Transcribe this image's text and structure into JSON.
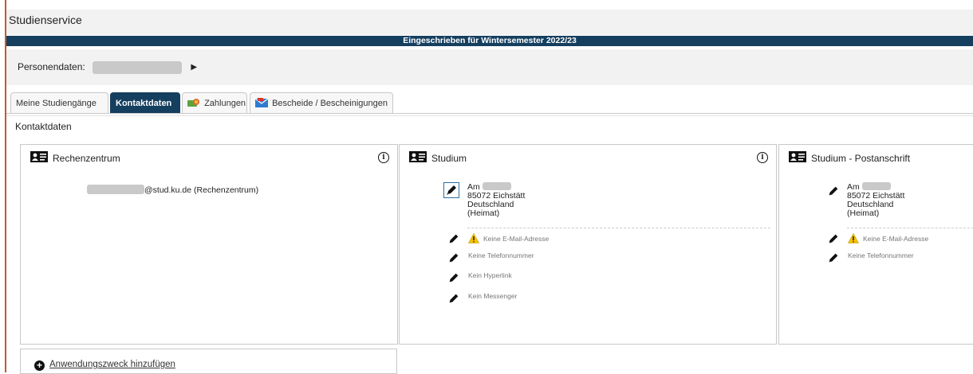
{
  "header": {
    "title": "Studienservice"
  },
  "banner": {
    "text": "Eingeschrieben für Wintersemester 2022/23"
  },
  "persona": {
    "label": "Personendaten:"
  },
  "tabs": [
    {
      "label": "Meine Studiengänge"
    },
    {
      "label": "Kontaktdaten"
    },
    {
      "label": "Zahlungen"
    },
    {
      "label": "Bescheide / Bescheinigungen"
    }
  ],
  "section": {
    "title": "Kontaktdaten"
  },
  "cards": {
    "rechenzentrum": {
      "title": "Rechenzentrum",
      "email_suffix": "@stud.ku.de (Rechenzentrum)"
    },
    "studium": {
      "title": "Studium",
      "address": {
        "street_prefix": "Am",
        "city": "85072 Eichstätt",
        "country": "Deutschland",
        "type": "(Heimat)"
      },
      "contacts": {
        "email": "Keine E-Mail-Adresse",
        "phone": "Keine Telefonnummer",
        "hyperlink": "Kein Hyperlink",
        "messenger": "Kein Messenger"
      }
    },
    "postanschrift": {
      "title": "Studium - Postanschrift",
      "address": {
        "street_prefix": "Am",
        "city": "85072 Eichstätt",
        "country": "Deutschland",
        "type": "(Heimat)"
      },
      "contacts": {
        "email": "Keine E-Mail-Adresse",
        "phone": "Keine Telefonnummer"
      }
    }
  },
  "actions": {
    "add_purpose": "Anwendungszweck hinzufügen"
  },
  "colors": {
    "primary": "#153f5f",
    "accent_rule": "#c65a2a",
    "warning": "#f5c400"
  },
  "icons": [
    "contact-card-icon",
    "info-icon",
    "pencil-icon",
    "warning-icon",
    "plus-circle-icon",
    "money-icon",
    "mail-icon",
    "caret-right-icon"
  ]
}
